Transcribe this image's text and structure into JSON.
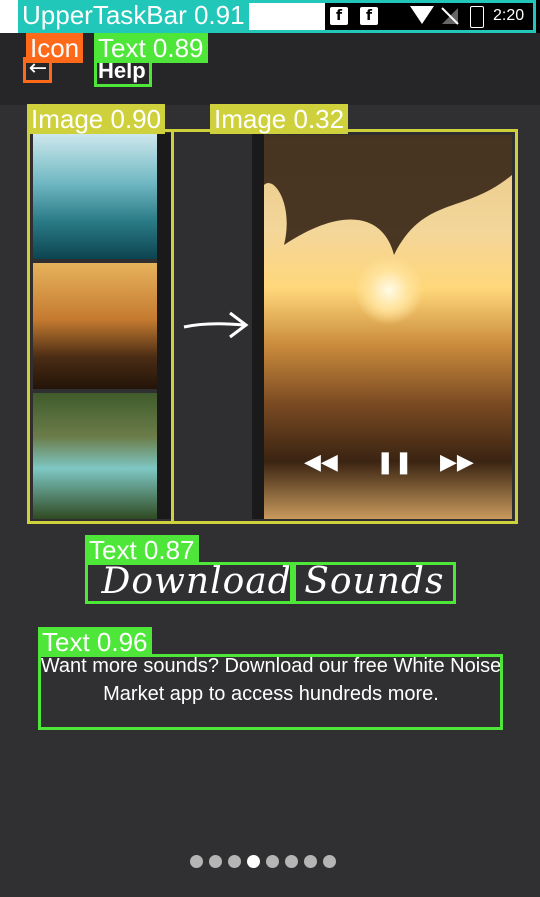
{
  "status_bar": {
    "time": "2:20",
    "icons": [
      "facebook-icon",
      "facebook-icon",
      "wifi-icon",
      "signal-icon",
      "battery-icon"
    ],
    "annotation_label": "UpperTaskBar 0.91"
  },
  "app_bar": {
    "title": "Help",
    "back_icon": "arrow-left-icon",
    "icon_annotation": "Icon",
    "title_annotation": "Text 0.89"
  },
  "illustration": {
    "annotation_left": "Image 0.90",
    "annotation_right": "Image 0.32",
    "thumbnails": [
      "waterfall",
      "beach",
      "river"
    ],
    "controls": [
      "rewind-icon",
      "pause-icon",
      "fast-forward-icon"
    ],
    "control_glyphs": [
      "◀◀",
      "❚❚",
      "▶▶"
    ]
  },
  "headline": {
    "text": "Download Sounds",
    "annotation": "Text 0.87"
  },
  "description": {
    "text": "Want more sounds? Download our free White Noise Market app to access hundreds more.",
    "annotation": "Text 0.96"
  },
  "pager": {
    "count": 8,
    "active_index": 3
  },
  "colors": {
    "annot_cyan": "#21c7b8",
    "annot_orange": "#ff6a1a",
    "annot_green": "#4fe63a",
    "annot_yellow": "#cfd13c"
  }
}
